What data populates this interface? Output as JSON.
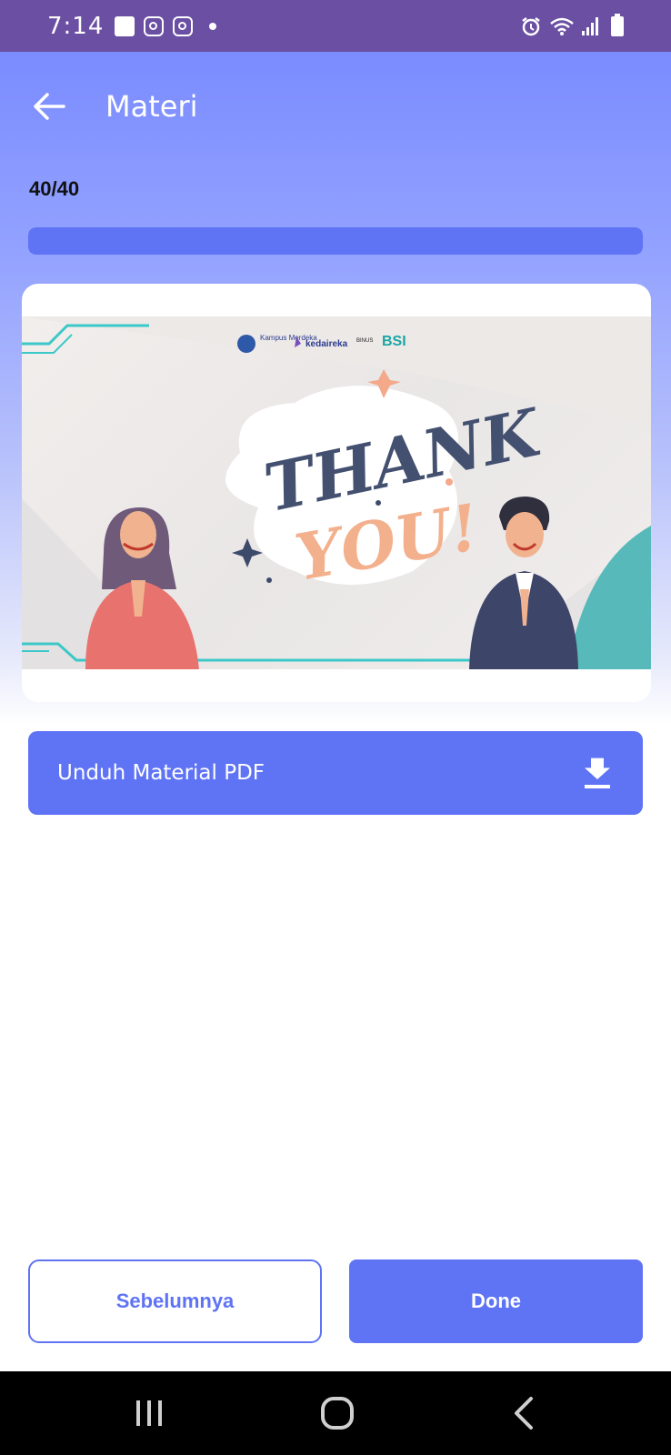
{
  "status_bar": {
    "time": "7:14",
    "icons": [
      "gallery-icon",
      "instagram-icon",
      "instagram-icon",
      "dot-icon",
      "alarm-icon",
      "wifi-icon",
      "signal-icon",
      "battery-icon"
    ]
  },
  "app_bar": {
    "title": "Materi",
    "back_icon": "arrow-left-icon"
  },
  "progress": {
    "label": "40/40",
    "current": 40,
    "total": 40,
    "fraction": 1.0,
    "fill_color": "#5f73f5"
  },
  "slide": {
    "logos": [
      "Kampus Merdeka",
      "kedaireka",
      "BINUS",
      "BSI"
    ],
    "headline_1": "THANK",
    "headline_2": "YOU!"
  },
  "download": {
    "label": "Unduh Material PDF",
    "icon": "download-icon"
  },
  "buttons": {
    "previous": "Sebelumnya",
    "done": "Done"
  },
  "nav_bar": {
    "icons": [
      "recents-icon",
      "home-icon",
      "back-icon"
    ]
  },
  "colors": {
    "status_bar": "#6a4fa3",
    "accent": "#5f73f5"
  }
}
